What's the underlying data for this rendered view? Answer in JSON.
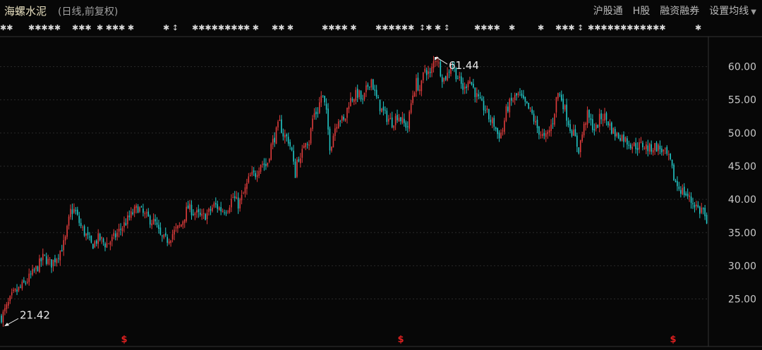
{
  "header": {
    "stock_name": "海螺水泥",
    "subtitle": "(日线,前复权)",
    "menu": [
      "沪股通",
      "H股",
      "融资融券",
      "设置均线"
    ]
  },
  "colors": {
    "up": "#e03c3c",
    "down": "#22c6c6",
    "grid": "#2a2a2a",
    "marker": "#e02020"
  },
  "event_markers": [
    {
      "text": "✱✱",
      "x": 0
    },
    {
      "text": "✱✱✱✱✱",
      "x": 40
    },
    {
      "text": "✱✱✱",
      "x": 102
    },
    {
      "text": "✱ ✱✱✱ ✱",
      "x": 137
    },
    {
      "text": "✱ ↕",
      "x": 231
    },
    {
      "text": "✱✱✱✱✱✱✱✱",
      "x": 272
    },
    {
      "text": "✱  ✱",
      "x": 345
    },
    {
      "text": "✱✱ ✱",
      "x": 385
    },
    {
      "text": "✱✱✱✱ ✱",
      "x": 456
    },
    {
      "text": "✱✱✱✱✱✱",
      "x": 532
    },
    {
      "text": "↕✱ ✱ ↕",
      "x": 594
    },
    {
      "text": "✱✱✱✱",
      "x": 672
    },
    {
      "text": "✱",
      "x": 721
    },
    {
      "text": "✱",
      "x": 762
    },
    {
      "text": "✱✱✱ ↕",
      "x": 787
    },
    {
      "text": "✱✱✱✱✱✱✱✱✱✱✱✱",
      "x": 833
    },
    {
      "text": "✱",
      "x": 985
    }
  ],
  "chart_data": {
    "type": "candlestick",
    "y_ticks": [
      "60.00",
      "55.00",
      "50.00",
      "45.00",
      "40.00",
      "35.00",
      "30.00",
      "25.00"
    ],
    "ylim": [
      20.6,
      64.2
    ],
    "annotations": [
      {
        "label": "61.44",
        "value": 61.44,
        "position": "peak"
      },
      {
        "label": "21.42",
        "value": 21.42,
        "position": "start"
      }
    ],
    "bottom_markers": [
      "$",
      "$",
      "$"
    ],
    "close_path": [
      [
        0,
        21.9
      ],
      [
        8,
        23.4
      ],
      [
        18,
        25.6
      ],
      [
        30,
        26.8
      ],
      [
        40,
        28.0
      ],
      [
        52,
        29.6
      ],
      [
        62,
        31.4
      ],
      [
        72,
        30.2
      ],
      [
        82,
        31.6
      ],
      [
        92,
        33.6
      ],
      [
        100,
        38.2
      ],
      [
        106,
        38.4
      ],
      [
        114,
        36.0
      ],
      [
        122,
        34.6
      ],
      [
        130,
        33.0
      ],
      [
        140,
        34.2
      ],
      [
        150,
        33.2
      ],
      [
        160,
        34.0
      ],
      [
        170,
        35.4
      ],
      [
        180,
        36.8
      ],
      [
        190,
        38.2
      ],
      [
        196,
        38.8
      ],
      [
        204,
        37.6
      ],
      [
        212,
        37.0
      ],
      [
        220,
        36.4
      ],
      [
        228,
        34.2
      ],
      [
        236,
        33.8
      ],
      [
        246,
        35.0
      ],
      [
        256,
        36.0
      ],
      [
        266,
        38.8
      ],
      [
        276,
        38.0
      ],
      [
        286,
        37.2
      ],
      [
        296,
        38.0
      ],
      [
        304,
        39.2
      ],
      [
        314,
        38.4
      ],
      [
        322,
        38.6
      ],
      [
        330,
        40.4
      ],
      [
        338,
        39.2
      ],
      [
        346,
        41.0
      ],
      [
        354,
        43.4
      ],
      [
        362,
        43.8
      ],
      [
        370,
        45.6
      ],
      [
        378,
        45.0
      ],
      [
        384,
        48.0
      ],
      [
        390,
        49.6
      ],
      [
        396,
        51.6
      ],
      [
        402,
        49.6
      ],
      [
        408,
        49.2
      ],
      [
        414,
        47.0
      ],
      [
        418,
        43.4
      ],
      [
        422,
        46.8
      ],
      [
        426,
        45.6
      ],
      [
        432,
        49.2
      ],
      [
        438,
        48.6
      ],
      [
        444,
        52.8
      ],
      [
        450,
        53.2
      ],
      [
        456,
        56.0
      ],
      [
        462,
        53.4
      ],
      [
        468,
        47.6
      ],
      [
        474,
        50.6
      ],
      [
        480,
        52.4
      ],
      [
        488,
        51.6
      ],
      [
        494,
        54.6
      ],
      [
        500,
        55.4
      ],
      [
        508,
        56.0
      ],
      [
        514,
        54.6
      ],
      [
        520,
        56.8
      ],
      [
        526,
        58.2
      ],
      [
        532,
        55.6
      ],
      [
        540,
        53.6
      ],
      [
        548,
        52.4
      ],
      [
        556,
        51.6
      ],
      [
        564,
        52.8
      ],
      [
        572,
        51.4
      ],
      [
        578,
        51.0
      ],
      [
        584,
        55.4
      ],
      [
        590,
        57.6
      ],
      [
        596,
        56.4
      ],
      [
        602,
        59.8
      ],
      [
        610,
        58.6
      ],
      [
        616,
        61.4
      ],
      [
        622,
        60.2
      ],
      [
        628,
        58.0
      ],
      [
        634,
        58.8
      ],
      [
        640,
        60.6
      ],
      [
        646,
        59.0
      ],
      [
        652,
        57.6
      ],
      [
        658,
        56.4
      ],
      [
        664,
        58.4
      ],
      [
        670,
        57.0
      ],
      [
        676,
        55.4
      ],
      [
        682,
        54.2
      ],
      [
        688,
        53.6
      ],
      [
        694,
        52.0
      ],
      [
        700,
        51.4
      ],
      [
        706,
        49.6
      ],
      [
        712,
        50.2
      ],
      [
        718,
        53.6
      ],
      [
        724,
        54.6
      ],
      [
        730,
        55.4
      ],
      [
        736,
        55.8
      ],
      [
        742,
        54.6
      ],
      [
        748,
        53.8
      ],
      [
        754,
        52.8
      ],
      [
        760,
        51.0
      ],
      [
        766,
        50.0
      ],
      [
        772,
        49.0
      ],
      [
        778,
        50.2
      ],
      [
        784,
        52.0
      ],
      [
        790,
        56.2
      ],
      [
        796,
        55.2
      ],
      [
        802,
        53.0
      ],
      [
        808,
        50.8
      ],
      [
        814,
        49.6
      ],
      [
        820,
        47.4
      ],
      [
        826,
        50.2
      ],
      [
        832,
        52.8
      ],
      [
        838,
        51.4
      ],
      [
        844,
        50.4
      ],
      [
        850,
        52.2
      ],
      [
        856,
        52.6
      ],
      [
        862,
        51.6
      ],
      [
        868,
        50.4
      ],
      [
        874,
        49.6
      ],
      [
        880,
        49.6
      ],
      [
        888,
        48.8
      ],
      [
        896,
        48.2
      ],
      [
        904,
        48.0
      ],
      [
        912,
        48.2
      ],
      [
        920,
        47.6
      ],
      [
        928,
        48.0
      ],
      [
        936,
        47.6
      ],
      [
        944,
        46.8
      ],
      [
        950,
        45.6
      ],
      [
        956,
        42.8
      ],
      [
        962,
        41.8
      ],
      [
        968,
        41.2
      ],
      [
        974,
        40.6
      ],
      [
        980,
        39.6
      ],
      [
        986,
        39.2
      ],
      [
        992,
        38.2
      ],
      [
        996,
        38.8
      ],
      [
        1002,
        35.6
      ]
    ]
  }
}
